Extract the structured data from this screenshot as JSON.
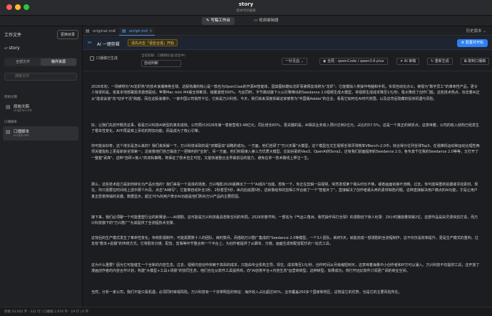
{
  "window": {
    "title": "story",
    "subtitle": "版本时间编辑"
  },
  "modes": [
    {
      "label": "写稿工作台"
    },
    {
      "label": "视频编辑器"
    }
  ],
  "sidebar": {
    "header": "工作文件",
    "change_dir": "更换目录",
    "project": "story",
    "segments": [
      "全部文件",
      "稿件资源"
    ],
    "search_placeholder": "搜索文件",
    "groups": [
      {
        "title": "原始文稿",
        "items": [
          {
            "name": "原始文稿",
            "file": "original.md"
          }
        ]
      },
      {
        "title": "口播脚本",
        "items": [
          {
            "name": "口播脚本",
            "file": "script.md"
          }
        ]
      }
    ]
  },
  "tabs": [
    {
      "label": "original.md"
    },
    {
      "label": "script.md"
    }
  ],
  "history_label": "历史版本",
  "ai_bar": {
    "title": "AI 一键剪辑",
    "tag": "请先点击「语音合成」开始",
    "config_button": "配置并开始"
  },
  "options": {
    "checkbox_label": "口播稿已生成",
    "current_label": "当前剪辑：口播稿标准(适合中)",
    "select_value": "自动判断",
    "style_select": "一针见血",
    "model_select": "全局 · qwenCode / qwen3.6-plus",
    "audit_button": "AI 审稿",
    "regen_button": "重新生成",
    "copy_button": "复制口播稿"
  },
  "paragraphs": [
    "2026年初，一场被称为\"AI龙虾热\"的技术浪潮席卷全球。这股热潮的核心是一款名为OpenClaw的开源AI智能体，因其图标酷似龙虾而被网友戏称为\"龙虾\"。它能模拟人类操作电脑和手机，实现自动化办公，被视为\"数字员工\"的革命性产品。更令人惊讶的是，受其本地部署需求激增驱动，苹果Mac mini M4版全球断货，销量激增300%，与此同时，字节跳动旗下火山引擎推出的Seedance 2.0视频生成大模型，将视频生成成本降至1元/秒，极大降低了创作门槛。这些技术热点，标志着AI正从\"能说会道\"向\"动手干活\"跨越，而在这股浪潮中，一家中国公司悄然卡位，它就是万兴科技，今天，我们就来深度拆解这家被誉为\"中国版Adobe\"的企业，看看它如何在AI时代突围，以及这背后隐藏的投资机遇与风险。",
    "好，让我们先抓开概念这事，看看万兴科技AI转型的真实成效。公司预计2026年第一季度营收3.48亿元，同比增长65%，更关键的是，AI相关业务收入预计达到2亿元，占比约57.5%。这是一个真正的转折点，这意味着，公司的收入结构已经发生了根本性变化，AI不再是锦上添花的附加功能，而是成为了核心引擎。",
    "你可能会好奇，这个增长是怎么来的？我们来拆解一下。万兴科技采取的是\"双模驱动\"战略的成功。一方面，他们自研了\"万兴天幕\"大模型，这个模型在文生视频全球评测榜单VBench-2.0中，综合得分位列全球Top3。在强推机运动和运动合理性两项关键指标上更是斩获全球第一。这就像他们自己锻造了一把锋利的\"宝剑\"。另一方面，他们积极接入第三方优质大模型，比如谷歌的Veo3、OpenAI的Sora2，还有我们前面提到的Seedance 2.0。各专其千位我的Seedance 2.0等等，又打开了一整套\"武库\"。这种\"自研+接入\"的双轨策略，既保证了技术自主可控，又能快速整合业界最前沿的能力，避免在单一技术路线上押注一生。",
    "那么，这些技术能力是如何转化为产品价值的？我们来看一个具体的场景。万兴喵影2026版推出了一个\"AI成片\"功能。想象一下，你正在剪辑一段视频，突然发现某个镜头时长不够，或者画面衔接不流畅。过去，你可能得重新拍摄或寻找素材。现在，你只需要在时间线上选中那个片段，点击\"AI续写\"，它能够自动补全1秒、2秒甚至5秒，纵向后延展5秒，这就像给你的剪辑工作台装了一个\"智能补丁\"，直接解决了创作者最头疼的素材缺陷问题。这种直接解决用户痛点的AI功能，才是让用户真正愿意掏钱的关键。数据显示，超过70%的用户表示AI功能是他们购买万兴产品的主要原因。",
    "接下来，我们必须聊一个可能重塑行业的新赛道——AI漫剧，这可能是万兴科技最具想象空间的布局。2026年春节档，一部名为《气运三角洲，我凭操作吊打全球》的漫剧创下惊人纪录：29小时播放量突破2亿。这部作品是由灵漫快剪打造，而万兴科技旗下的\"万兴剧厂\"为其提供了全流程技术支撑。",
    "这背后的生产模式发生了革命性变化。传统影视制作，可能需要数十人的团队、耗时数月。而借助万兴剧厂集成的\"Seedance 2.0等模型，一个3人团队，耗时5天，就能完成一部漫剧的全流程制作。这不仅仅是效率提升，更是生产模式的重构。过去有\"剧本+拍摄\"的传统方式，它将剧本分镜、配音、剪辑等环节整合到一个平台上，为创作者提供了从脚本、分镜、画面生成到配音配乐的一站式工具。",
    "这为什么重要？因为它可能催生一个全新的内容生态。过去，视频内容创作依赖于高昂的成本，只能由专业机构主导。现在，成本降至1元/秒，创作时间从月级缩短到天，这意味着海量中小创作者和IP方可以涌入。万兴科技不仅提供工具，还开放了漫画创作者的内容合作计划，构建\"大模型+工具+场景\"的协同生态，他们也在从软件工具提供商，向\"AI创意平台+内容生态\"运营商转型。这种转型，如果成功，将打开远比软件订阅更广阔的商业空间。",
    "当然，分析一家公司，我们不能只看机遇，必须同时审视风险。万兴科技有一个非常明显的特征：海外收入占比超过90%，业务覆盖200多个国家和地区，这既是它的优势，也是它的主要风险所在。"
  ],
  "status": {
    "text": "原稿 34,002 字 · 331 行 | 口播稿 2,976 字 · 19 行 | 0 字"
  }
}
